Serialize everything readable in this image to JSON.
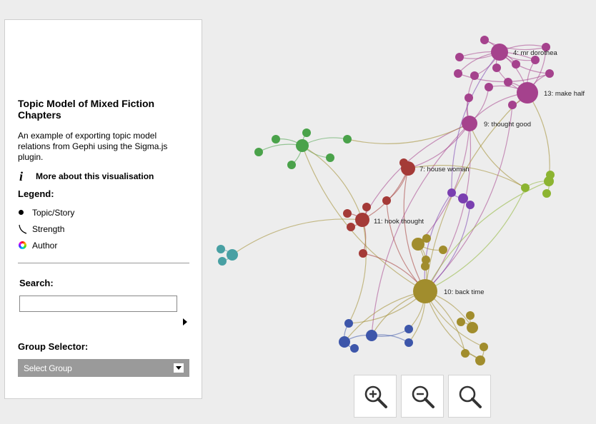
{
  "sidebar": {
    "title": "Topic Model of Mixed Fiction Chapters",
    "description": "An example of exporting topic model relations from Gephi using the Sigma.js plugin.",
    "more_link": "More about this visualisation",
    "legend_heading": "Legend:",
    "legend_items": [
      "Topic/Story",
      "Strength",
      "Author"
    ],
    "search_heading": "Search:",
    "search_value": "",
    "group_heading": "Group Selector:",
    "group_selected": "Select Group"
  },
  "zoom_controls": {
    "icons": [
      "zoom-in-icon",
      "zoom-out-icon",
      "zoom-reset-icon"
    ]
  },
  "graph": {
    "colors": {
      "purple": "#a5428d",
      "violet": "#7a3fb0",
      "red": "#a43a37",
      "green": "#4aa24a",
      "olive": "#a18d2d",
      "lime": "#8cb431",
      "blue": "#3d56aa",
      "teal": "#48a0a3"
    },
    "labels": {
      "n4": "4: mr dorothea",
      "n13": "13: make half",
      "n9": "9: thought good",
      "n7": "7: house woman",
      "n11": "11: hook thought",
      "n10": "10: back time"
    }
  }
}
